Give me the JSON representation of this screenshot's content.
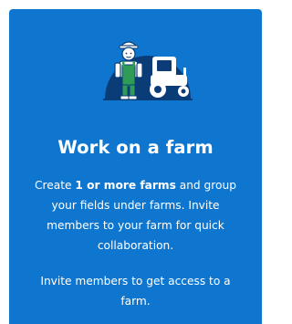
{
  "card": {
    "title": "Work on a farm",
    "description": {
      "before_bold": "Create ",
      "bold": "1 or more farms",
      "after_bold": " and group your fields under farms. Invite members to your farm for quick collaboration."
    },
    "invite_note": "Invite members to get access to a farm.",
    "illustration": "farmer-with-tractor-illustration",
    "colors": {
      "card_background": "#0f76d0",
      "illustration_circle": "#0a3d78",
      "text": "#ffffff"
    }
  }
}
